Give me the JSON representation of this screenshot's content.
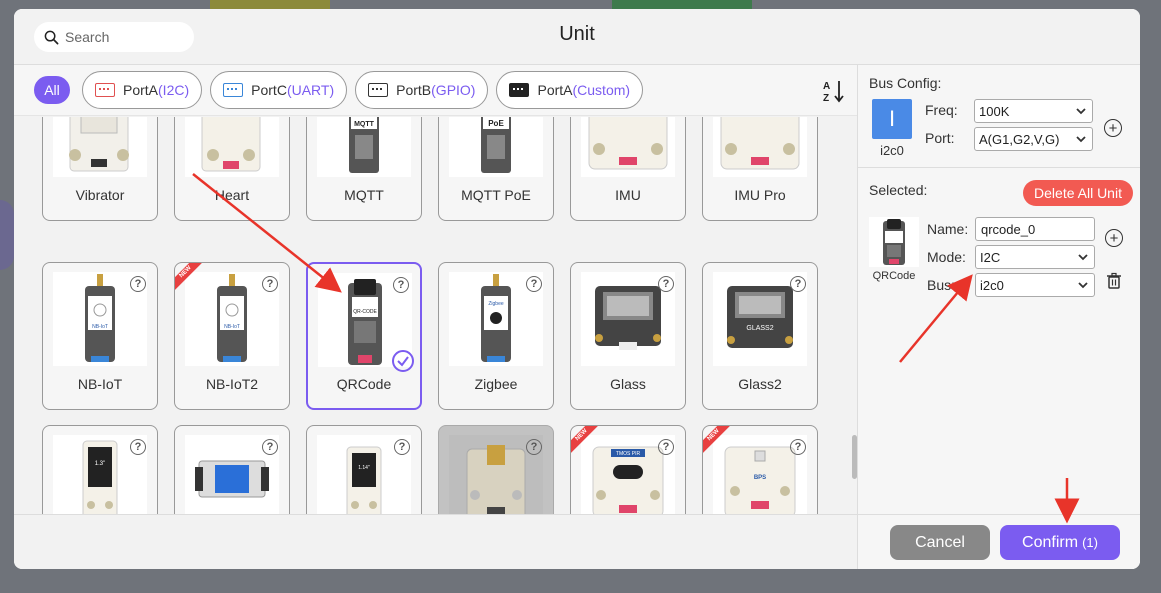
{
  "dialog": {
    "title": "Unit"
  },
  "search": {
    "placeholder": "Search"
  },
  "filters": {
    "all": "All",
    "chips": [
      {
        "prefix": "PortA",
        "accent": "(I2C)",
        "icon_color": "#e05050"
      },
      {
        "prefix": "PortC",
        "accent": "(UART)",
        "icon_color": "#3a86d8"
      },
      {
        "prefix": "PortB",
        "accent": "(GPIO)",
        "icon_color": "#333333"
      },
      {
        "prefix": "PortA",
        "accent": "(Custom)",
        "icon_color": "#222222"
      }
    ],
    "sort_icon": "sort-az-icon"
  },
  "units": [
    {
      "label": "Vibrator"
    },
    {
      "label": "Heart"
    },
    {
      "label": "MQTT"
    },
    {
      "label": "MQTT PoE"
    },
    {
      "label": "IMU"
    },
    {
      "label": "IMU Pro"
    },
    {
      "label": "NB-IoT"
    },
    {
      "label": "NB-IoT2",
      "badge": "NEW"
    },
    {
      "label": "QRCode",
      "selected": true
    },
    {
      "label": "Zigbee"
    },
    {
      "label": "Glass"
    },
    {
      "label": "Glass2"
    },
    {
      "label": ""
    },
    {
      "label": ""
    },
    {
      "label": ""
    },
    {
      "label": ""
    },
    {
      "label": "",
      "badge": "NEW"
    },
    {
      "label": "",
      "badge": "NEW"
    }
  ],
  "bus_config": {
    "title": "Bus Config:",
    "badge_letter": "I",
    "badge_caption": "i2c0",
    "freq_label": "Freq:",
    "freq_value": "100K",
    "port_label": "Port:",
    "port_value": "A(G1,G2,V,G)"
  },
  "selected": {
    "title": "Selected:",
    "delete_all": "Delete All Unit",
    "unit_caption": "QRCode",
    "name_label": "Name:",
    "name_value": "qrcode_0",
    "mode_label": "Mode:",
    "mode_value": "I2C",
    "bus_label": "Bus:",
    "bus_value": "i2c0"
  },
  "footer": {
    "cancel": "Cancel",
    "confirm": "Confirm",
    "confirm_count": "(1)"
  },
  "colors": {
    "accent": "#7b5cf0",
    "danger": "#f25a52",
    "annotation": "#e8342a"
  }
}
